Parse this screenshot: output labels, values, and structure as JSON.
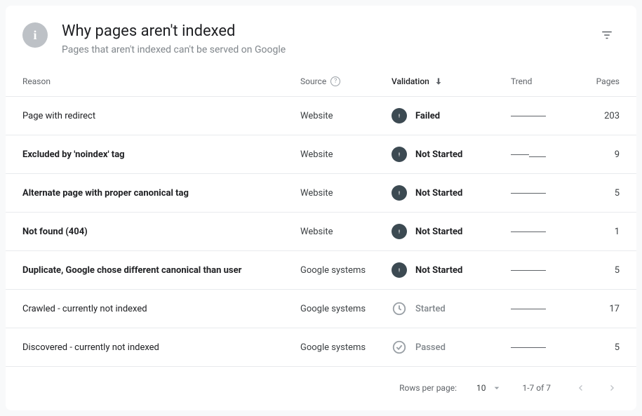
{
  "header": {
    "title": "Why pages aren't indexed",
    "subtitle": "Pages that aren't indexed can't be served on Google"
  },
  "columns": {
    "reason": "Reason",
    "source": "Source",
    "validation": "Validation",
    "trend": "Trend",
    "pages": "Pages"
  },
  "rows": [
    {
      "reason": "Page with redirect",
      "source": "Website",
      "validation": "Failed",
      "val_style": "dark-bold",
      "pages": "203",
      "bold": false,
      "trend": "flat"
    },
    {
      "reason": "Excluded by 'noindex' tag",
      "source": "Website",
      "validation": "Not Started",
      "val_style": "dark-bold",
      "pages": "9",
      "bold": true,
      "trend": "step"
    },
    {
      "reason": "Alternate page with proper canonical tag",
      "source": "Website",
      "validation": "Not Started",
      "val_style": "dark-bold",
      "pages": "5",
      "bold": true,
      "trend": "flat"
    },
    {
      "reason": "Not found (404)",
      "source": "Website",
      "validation": "Not Started",
      "val_style": "dark-bold",
      "pages": "1",
      "bold": true,
      "trend": "flat"
    },
    {
      "reason": "Duplicate, Google chose different canonical than user",
      "source": "Google systems",
      "validation": "Not Started",
      "val_style": "dark-bold",
      "pages": "5",
      "bold": true,
      "trend": "flat"
    },
    {
      "reason": "Crawled - currently not indexed",
      "source": "Google systems",
      "validation": "Started",
      "val_style": "clock-muted",
      "pages": "17",
      "bold": false,
      "trend": "flat"
    },
    {
      "reason": "Discovered - currently not indexed",
      "source": "Google systems",
      "validation": "Passed",
      "val_style": "check-muted",
      "pages": "5",
      "bold": false,
      "trend": "flat"
    }
  ],
  "footer": {
    "rows_per_page_label": "Rows per page:",
    "rows_per_page_value": "10",
    "range": "1-7 of 7"
  }
}
